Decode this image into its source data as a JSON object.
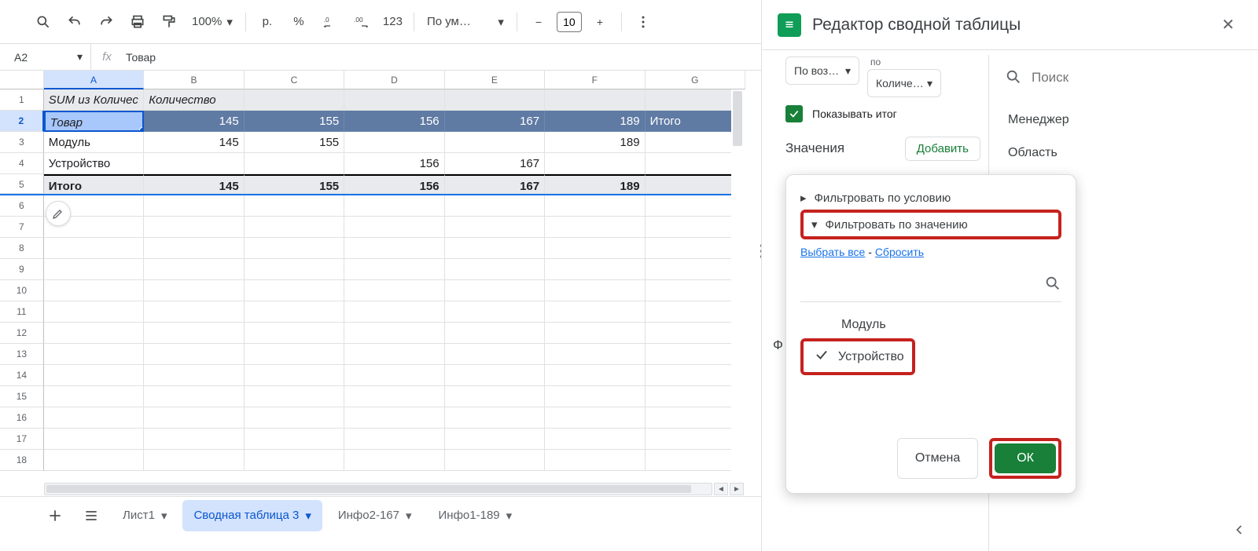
{
  "toolbar": {
    "zoom": "100%",
    "currency": "р.",
    "percent": "%",
    "numfmt": "123",
    "font_label": "По ум…",
    "font_size": "10"
  },
  "namebox": "A2",
  "fx": "fx",
  "formula_text": "Товар",
  "columns": [
    "A",
    "B",
    "C",
    "D",
    "E",
    "F",
    "G"
  ],
  "rows": [
    {
      "n": "1",
      "cells": [
        "SUM из Количес",
        "Количество",
        "",
        "",
        "",
        "",
        ""
      ]
    },
    {
      "n": "2",
      "cells": [
        "Товар",
        "145",
        "155",
        "156",
        "167",
        "189",
        "Итого"
      ]
    },
    {
      "n": "3",
      "cells": [
        "Модуль",
        "145",
        "155",
        "",
        "",
        "189",
        ""
      ]
    },
    {
      "n": "4",
      "cells": [
        "Устройство",
        "",
        "",
        "156",
        "167",
        "",
        ""
      ]
    },
    {
      "n": "5",
      "cells": [
        "Итого",
        "145",
        "155",
        "156",
        "167",
        "189",
        ""
      ]
    }
  ],
  "sheets": {
    "add_tip": "+",
    "all_tip": "≡",
    "tabs": [
      {
        "label": "Лист1",
        "active": false
      },
      {
        "label": "Сводная таблица 3",
        "active": true
      },
      {
        "label": "Инфо2-167",
        "active": false
      },
      {
        "label": "Инфо1-189",
        "active": false
      }
    ]
  },
  "sidebar": {
    "title": "Редактор сводной таблицы",
    "sort_dir": "По воз…",
    "sort_by_top": "по",
    "sort_by": "Количе…",
    "show_total": "Показывать итог",
    "values_label": "Значения",
    "add_label": "Добавить",
    "f_letter": "Ф",
    "filter": {
      "by_condition": "Фильтровать по условию",
      "by_value": "Фильтровать по значению",
      "select_all": "Выбрать все",
      "dash": " - ",
      "reset": "Сбросить",
      "search_placeholder": "",
      "items": [
        {
          "label": "Модуль",
          "checked": false
        },
        {
          "label": "Устройство",
          "checked": true
        }
      ],
      "cancel": "Отмена",
      "ok": "ОК"
    },
    "right": {
      "search_placeholder": "Поиск",
      "fields": [
        "Менеджер",
        "Область"
      ]
    }
  }
}
